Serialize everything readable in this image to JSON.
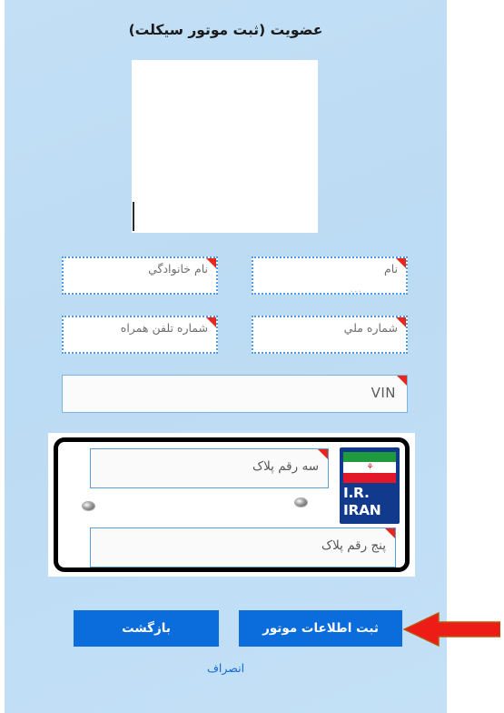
{
  "page": {
    "title": "عضویت (ثبت موتور سیکلت)",
    "background_color": "#bddcf4",
    "accent_color": "#0b6cdc",
    "required_marker_color": "#e8271a"
  },
  "photo_box": {
    "name": "image-preview-box",
    "content": ""
  },
  "fields": [
    {
      "id": "firstname",
      "placeholder": "نام",
      "sub_text": "...",
      "required": true,
      "style": "dotted"
    },
    {
      "id": "lastname",
      "placeholder": "نام خانوادگي",
      "sub_text": "",
      "required": true,
      "style": "dotted"
    },
    {
      "id": "nationalid",
      "placeholder": "شماره ملي",
      "sub_text": "",
      "required": true,
      "style": "dotted"
    },
    {
      "id": "mobile",
      "placeholder": "شماره تلفن همراه",
      "sub_text": "",
      "required": true,
      "style": "dotted"
    },
    {
      "id": "vin",
      "placeholder": "VIN",
      "sub_text": "",
      "required": true,
      "style": "solid"
    }
  ],
  "plate": {
    "country_code": "I.R.\nIRAN",
    "country_line1": "I.R.",
    "country_line2": "IRAN",
    "flag_colors": {
      "green": "#1f9b3d",
      "white": "#ffffff",
      "red": "#e2182a"
    },
    "three_digit": {
      "placeholder": "سه رقم پلاک",
      "value": "",
      "required": true
    },
    "five_digit": {
      "placeholder": "پنج رقم پلاک",
      "value": "",
      "required": true
    }
  },
  "actions": {
    "submit_label": "ثبت اطلاعات موتور",
    "back_label": "بازگشت",
    "cancel_label": "انصراف"
  },
  "annotation": {
    "arrow_color": "#ee1c16",
    "arrow_direction": "left",
    "points_at": "submit-button"
  }
}
